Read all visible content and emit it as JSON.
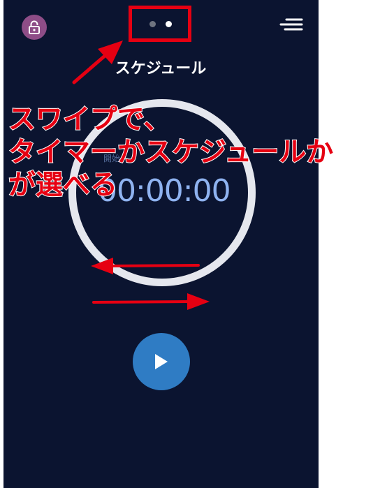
{
  "header": {
    "title": "スケジュール",
    "lock_icon": "lock-icon",
    "menu_icon": "menu-icon",
    "page_indicator": {
      "pages": 2,
      "active": 2
    }
  },
  "timer": {
    "display": "00:00:00",
    "sub_label": "開始"
  },
  "controls": {
    "play_icon": "play-icon"
  },
  "annotation": {
    "lines": [
      "スワイプで、",
      "タイマーかスケジュールか",
      "が選べる"
    ],
    "color": "#e60012"
  },
  "colors": {
    "background": "#0b1430",
    "accent": "#2f7cc4",
    "lock_button": "#8e4d87",
    "timer_text": "#8fb3f0"
  }
}
